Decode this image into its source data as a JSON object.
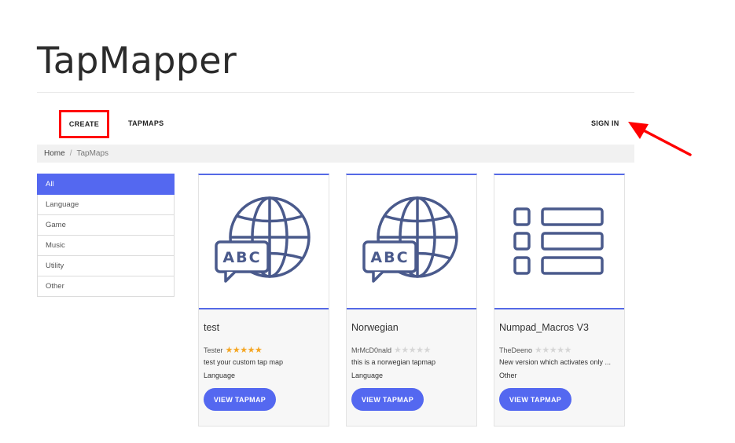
{
  "header": {
    "title": "TapMapper"
  },
  "nav": {
    "create": "CREATE",
    "tapmaps": "TAPMAPS",
    "signin": "SIGN IN"
  },
  "breadcrumb": {
    "home": "Home",
    "separator": "/",
    "current": "TapMaps"
  },
  "categories": [
    "All",
    "Language",
    "Game",
    "Music",
    "Utility",
    "Other"
  ],
  "active_category": "All",
  "cards": [
    {
      "title": "test",
      "author": "Tester",
      "rating": 5,
      "description": "test your custom tap map",
      "category": "Language",
      "button": "VIEW TAPMAP",
      "icon": "globe-abc-icon"
    },
    {
      "title": "Norwegian",
      "author": "MrMcD0nald",
      "rating": 0,
      "description": "this is a norwegian tapmap",
      "category": "Language",
      "button": "VIEW TAPMAP",
      "icon": "globe-abc-icon"
    },
    {
      "title": "Numpad_Macros V3",
      "author": "TheDeeno",
      "rating": 0,
      "description": "New version which activates only ...",
      "category": "Other",
      "button": "VIEW TAPMAP",
      "icon": "list-icon"
    }
  ],
  "colors": {
    "accent": "#5468f0",
    "highlight": "#ff0000",
    "star": "#f5a623"
  }
}
